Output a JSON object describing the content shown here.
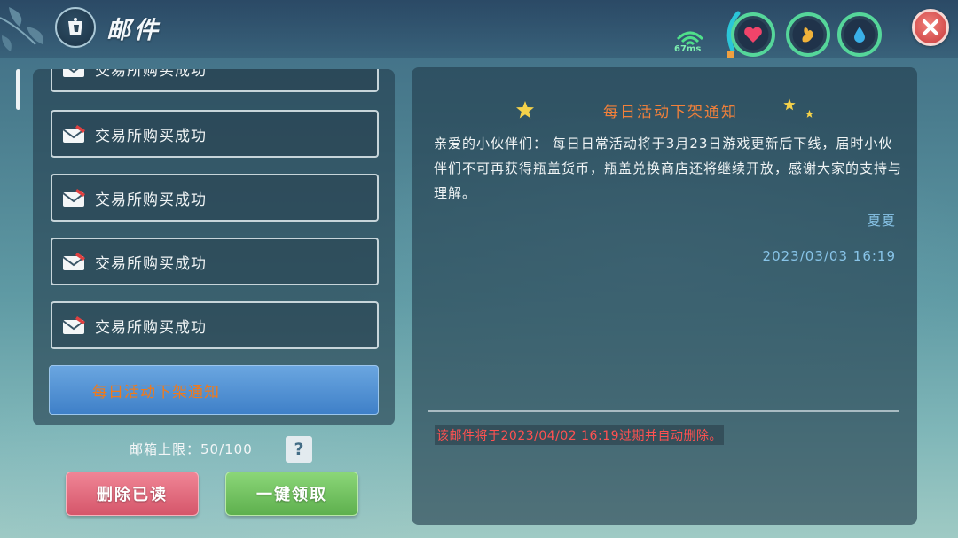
{
  "header": {
    "title": "邮件",
    "ping": "67ms",
    "back_icon": "cup-icon",
    "status_icons": [
      "heart-icon",
      "stomach-icon",
      "water-drop-icon"
    ],
    "close_icon": "close-icon"
  },
  "mail_list": {
    "items": [
      {
        "label": "交易所购买成功",
        "partial": true
      },
      {
        "label": "交易所购买成功"
      },
      {
        "label": "交易所购买成功"
      },
      {
        "label": "交易所购买成功"
      },
      {
        "label": "交易所购买成功"
      },
      {
        "label": "每日活动下架通知",
        "selected": true
      }
    ]
  },
  "footer": {
    "mailbox_limit": "邮箱上限：50/100",
    "help_label": "?",
    "delete_read_label": "删除已读",
    "claim_all_label": "一键领取"
  },
  "mail_detail": {
    "title": "每日活动下架通知",
    "body": "亲爱的小伙伴们： 每日日常活动将于3月23日游戏更新后下线，届时小伙伴们不可再获得瓶盖货币，瓶盖兑换商店还将继续开放，感谢大家的支持与理解。",
    "sender": "夏夏",
    "date": "2023/03/03 16:19",
    "expire_notice": "该邮件将于2023/04/02 16:19过期并自动删除。"
  },
  "colors": {
    "accent_orange": "#f2803a",
    "expire_red": "#ff5151",
    "date_blue": "#88c4e8",
    "delete_button": "#e06a7c",
    "claim_button": "#74c462",
    "selected_item": "#5592d4"
  }
}
